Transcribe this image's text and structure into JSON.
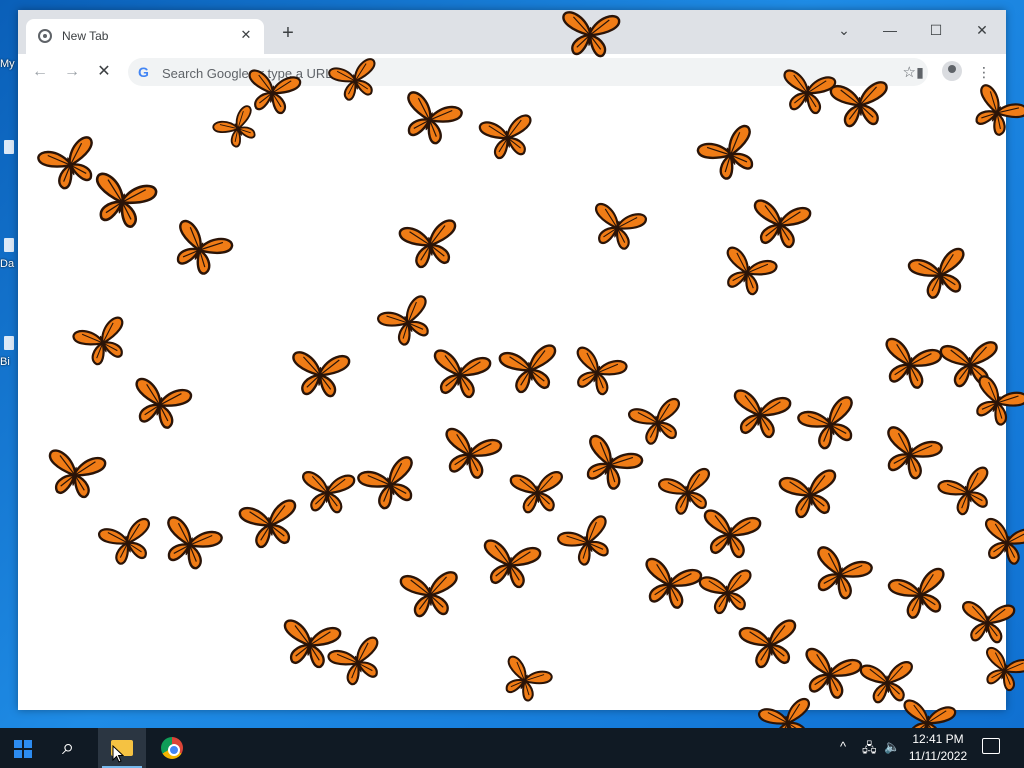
{
  "desktop": {
    "labels": [
      "My",
      "Da",
      "Bi"
    ]
  },
  "browser": {
    "tab": {
      "title": "New Tab",
      "close_glyph": "✕"
    },
    "new_tab_glyph": "+",
    "window_controls": {
      "menu": "⌄",
      "minimize": "—",
      "maximize": "☐",
      "close": "✕"
    },
    "toolbar": {
      "back_glyph": "←",
      "forward_glyph": "→",
      "stop_glyph": "✕",
      "omnibox_placeholder": "Search Google or type a URL",
      "google_glyph": "G",
      "star_glyph": "☆",
      "sidepanel_glyph": "▮",
      "menu_glyph": "⋮"
    },
    "content": "butterfly-swarm"
  },
  "colors": {
    "butterfly_wing": "#f07c16",
    "butterfly_vein": "#2a1408",
    "accent": "#1a73e8"
  },
  "taskbar": {
    "search_glyph": "⌕",
    "tray": {
      "chevron": "^",
      "network": "🖧",
      "volume": "🔈"
    },
    "clock": {
      "time": "12:41 PM",
      "date": "11/11/2022"
    }
  }
}
